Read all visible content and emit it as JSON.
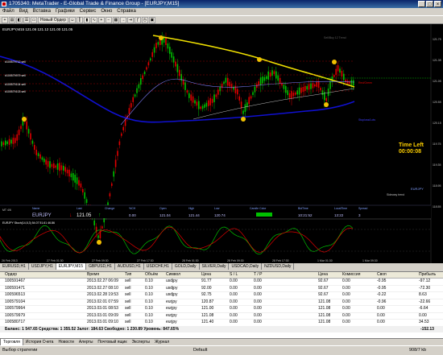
{
  "window": {
    "title": "1705340: MetaTrader - E-Global Trade & Finance Group - [EURJPY,M15]",
    "buttons": [
      "_",
      "□",
      "×"
    ]
  },
  "menu": [
    "Файл",
    "Вид",
    "Вставка",
    "Графики",
    "Сервис",
    "Окно",
    "Справка"
  ],
  "toolbar": {
    "new_order": "Новый Ордер"
  },
  "chart": {
    "symbol_info": "EURJPY,M15  121.06  121.12  121.00  121.05",
    "time_left_label": "Time Left",
    "time_left_value": "00:00:08",
    "symbol_label": "EURJPY",
    "sideways_label": "Sideway trend",
    "x_labels": [
      "26 Feb 2013",
      "27 Feb 01:30",
      "27 Feb 09:30",
      "27 Feb 17:30",
      "28 Feb 01:30",
      "28 Feb 09:30",
      "28 Feb 17:30",
      "1 Mar 01:30",
      "1 Mar 09:30"
    ],
    "y_labels": [
      "121.75",
      "121.35",
      "121.05",
      "120.55",
      "120.15",
      "119.75",
      "119.35",
      "118.95",
      "118.55"
    ],
    "colors": {
      "yellow": "#f0e000",
      "blue": "#1010d0",
      "green": "#00c000",
      "red": "#e00000",
      "orange": "#ff8000"
    },
    "order_labels": [
      "#100579712 sell",
      "#100579979 sell",
      "#100579104 sell",
      "#100579103 sell"
    ],
    "right_labels": [
      "Sell/Buy 12 Trend",
      "Red/Green",
      "Stoploss/Lots"
    ],
    "info_bar": {
      "headers": [
        "Name",
        "Last",
        "Change",
        "%CH",
        "Open",
        "High",
        "Low",
        "Candle Color",
        "BidTime",
        "LocalTime",
        "Spread"
      ],
      "values": [
        "EURJPY",
        "121.05",
        "",
        "0.00",
        "121.04",
        "121.44",
        "120.74",
        "",
        "10:21:52",
        "13:22",
        "3"
      ],
      "time_code": "MT 4/6"
    },
    "osc_label": "EURJPY Stoch(14,5,3) 54.07 51.61 46.86"
  },
  "symbol_tabs": [
    "EURUSD,H1",
    "USDJPY,H1",
    "EURJPY,M15",
    "GBPUSD,H1",
    "AUDUSD,H1",
    "USDCHF,H1",
    "GOLD,Daily",
    "SILVER,Daily",
    "USDCAD,Daily",
    "NZDUSD,Daily"
  ],
  "active_symbol_tab": "EURJPY,M15",
  "terminal": {
    "headers": [
      "Ордер",
      "Время",
      "Тип",
      "Объём",
      "Символ",
      "Цена",
      "S / L",
      "T / P",
      "Цена",
      "Комиссия",
      "Своп",
      "Прибыль"
    ],
    "rows": [
      [
        "100591467",
        "2013.02.27 06:09",
        "sell",
        "0.10",
        "usdjpy",
        "91.77",
        "0.00",
        "0.00",
        "92.67",
        "0.00",
        "-0.95",
        "-97.12"
      ],
      [
        "100591471",
        "2013.02.27 08:10",
        "sell",
        "0.10",
        "usdjpy",
        "92.00",
        "0.00",
        "0.00",
        "92.67",
        "0.00",
        "-0.95",
        "-72.30"
      ],
      [
        "100596513",
        "2013.02.28 19:53",
        "sell",
        "0.10",
        "usdjpy",
        "92.75",
        "0.00",
        "0.00",
        "92.67",
        "0.00",
        "-0.22",
        "8.63"
      ],
      [
        "100579104",
        "2013.02.01 07:59",
        "sell",
        "0.10",
        "eurjpy",
        "120.87",
        "0.00",
        "0.00",
        "121.08",
        "0.00",
        "-0.96",
        "-22.66"
      ],
      [
        "100579964",
        "2013.03.01 08:53",
        "sell",
        "0.10",
        "eurjpy",
        "121.00",
        "0.00",
        "0.00",
        "121.08",
        "0.00",
        "0.00",
        "-6.64"
      ],
      [
        "100579979",
        "2013.03.01 09:09",
        "sell",
        "0.10",
        "eurjpy",
        "121.08",
        "0.00",
        "0.00",
        "121.08",
        "0.00",
        "0.00",
        "0.00"
      ],
      [
        "100580717",
        "2013.03.01 09:10",
        "sell",
        "0.10",
        "eurjpy",
        "121.40",
        "0.00",
        "0.00",
        "121.08",
        "0.00",
        "0.00",
        "34.53"
      ]
    ],
    "balance_text": "Баланс: 1 547.65  Средства: 1 355.52  Залог: 184.63  Свободно: 1 230.89  Уровень: 847.65%",
    "balance_total": "-152.13"
  },
  "bottom_tabs": [
    "Торговля",
    "История Счета",
    "Новости",
    "Алерты",
    "Почтовый ящик",
    "Эксперты",
    "Журнал"
  ],
  "active_bottom_tab": "Торговля",
  "status": {
    "left": "Выбор стратегии",
    "mid": "Default",
    "right": "908/7 kb"
  }
}
